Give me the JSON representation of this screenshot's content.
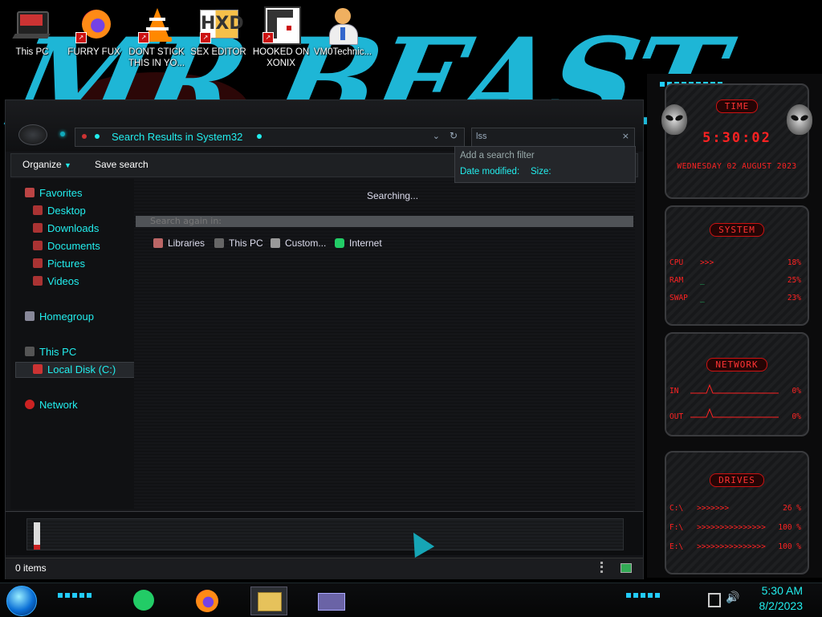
{
  "desktop": {
    "icons": [
      {
        "label": "This PC"
      },
      {
        "label": "FURRY FUX"
      },
      {
        "label": "DONT STICK THIS IN YO..."
      },
      {
        "label": "SEX EDITOR"
      },
      {
        "label": "HOOKED ON XONIX"
      },
      {
        "label": "VM0Technic..."
      }
    ]
  },
  "explorer": {
    "address": "Search Results in System32",
    "search_query": "lss",
    "toolbar": {
      "organize": "Organize",
      "save_search": "Save search"
    },
    "nav": {
      "favorites": "Favorites",
      "desktop": "Desktop",
      "downloads": "Downloads",
      "documents": "Documents",
      "pictures": "Pictures",
      "videos": "Videos",
      "homegroup": "Homegroup",
      "this_pc": "This PC",
      "local_disk": "Local Disk (C:)",
      "network": "Network"
    },
    "content": {
      "status": "Searching...",
      "search_again": "Search again in:",
      "locations": [
        "Libraries",
        "This PC",
        "Custom...",
        "Internet"
      ]
    },
    "filter": {
      "header": "Add a search filter",
      "options": [
        "Date modified:",
        "Size:"
      ]
    },
    "status_items": "0 items"
  },
  "gadgets": {
    "time": {
      "title": "TIME",
      "clock": "5:30:02",
      "date": "WEDNESDAY 02 AUGUST 2023"
    },
    "system": {
      "title": "SYSTEM",
      "rows": [
        {
          "label": "CPU",
          "value": "18%"
        },
        {
          "label": "RAM",
          "value": "25%"
        },
        {
          "label": "SWAP",
          "value": "23%"
        }
      ]
    },
    "network": {
      "title": "NETWORK",
      "rows": [
        {
          "label": "IN",
          "value": "0%"
        },
        {
          "label": "OUT",
          "value": "0%"
        }
      ]
    },
    "drives": {
      "title": "DRIVES",
      "rows": [
        {
          "label": "C:\\",
          "value": "26 %"
        },
        {
          "label": "F:\\",
          "value": "100 %"
        },
        {
          "label": "E:\\",
          "value": "100 %"
        }
      ]
    }
  },
  "taskbar": {
    "time": "5:30 AM",
    "date": "8/2/2023"
  }
}
